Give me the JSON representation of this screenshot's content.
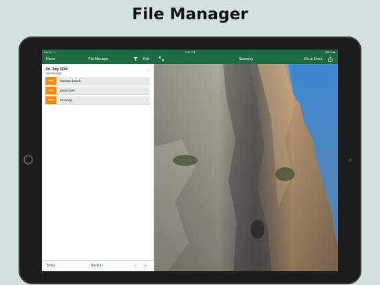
{
  "headline": "File Manager",
  "status_bar": {
    "carrier": "Carrier ᯤ",
    "time": "4:11 PM",
    "battery": "100% ▬"
  },
  "nav": {
    "home": "Home",
    "title": "File Manager",
    "edit": "Edit",
    "detail_title": "Stunning",
    "go_to_event": "Go to Event"
  },
  "list": {
    "date": "04. July 2018",
    "weekday": "Wednesday",
    "badge": "27",
    "files": [
      {
        "type": "jpeg",
        "name": "fantastic beach"
      },
      {
        "type": "jpeg",
        "name": "great hotel"
      },
      {
        "type": "jpeg",
        "name": "Stunning"
      }
    ]
  },
  "toolbar": {
    "today": "Today",
    "backup": "Backup",
    "prev": "‹",
    "next": "›"
  },
  "colors": {
    "brand_green": "#1e6a44",
    "thumb_orange": "#f08a12",
    "sky": "#4f9ae0"
  },
  "icons": [
    "filter-icon",
    "expand-icon",
    "share-icon",
    "chevron-right-icon"
  ]
}
